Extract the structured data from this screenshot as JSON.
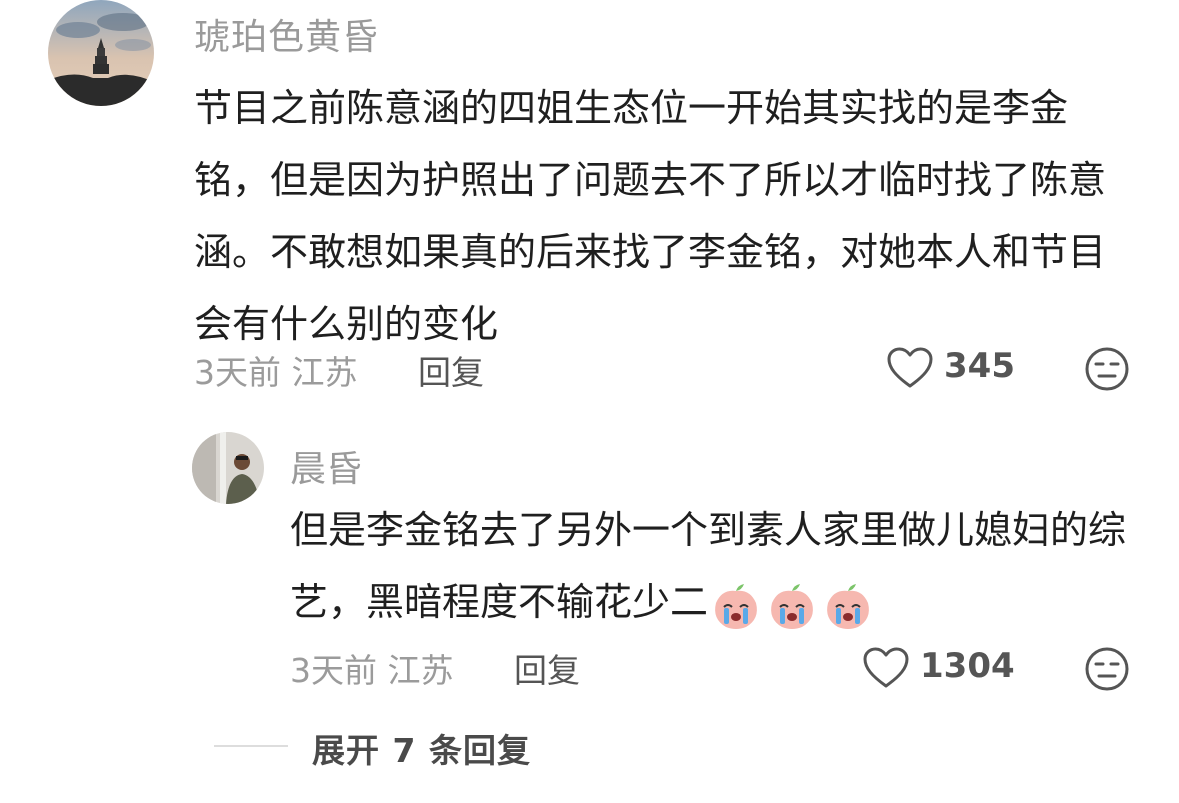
{
  "comment": {
    "username": "琥珀色黄昏",
    "text": "节目之前陈意涵的四姐生态位一开始其实找的是李金铭，但是因为护照出了问题去不了所以才临时找了陈意涵。不敢想如果真的后来找了李金铭，对她本人和节目会有什么别的变化",
    "meta": "3天前 江苏",
    "reply_label": "回复",
    "likes": "345",
    "like_icon": "heart-outline-icon",
    "dislike_icon": "meh-face-icon"
  },
  "reply": {
    "username": "晨昏",
    "text": "但是李金铭去了另外一个到素人家里做儿媳妇的综艺，黑暗程度不输花少二",
    "emoji_name": "crying-peach-emoji",
    "emoji_count": 3,
    "meta": "3天前 江苏",
    "reply_label": "回复",
    "likes": "1304"
  },
  "expand": {
    "label": "展开 7 条回复"
  },
  "colors": {
    "username": "#9a9a9a",
    "text": "#1f1f1f",
    "meta": "#9b9b9b",
    "action": "#555555"
  }
}
